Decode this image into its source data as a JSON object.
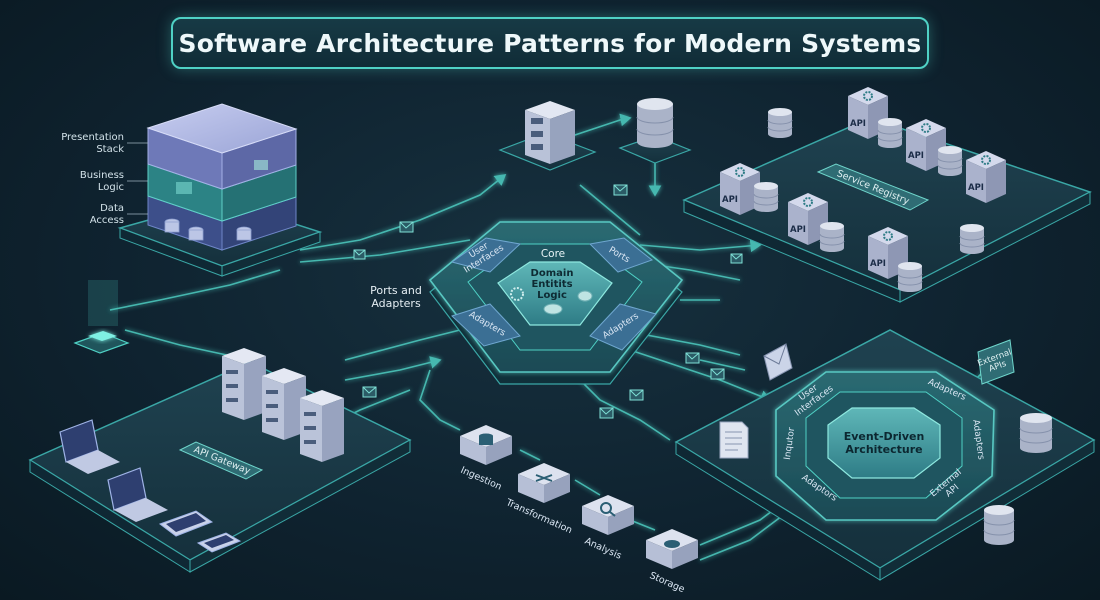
{
  "title": "Software Architecture Patterns for Modern Systems",
  "layered": {
    "labels": [
      {
        "line1": "Presentation",
        "line2": "Stack"
      },
      {
        "line1": "Business",
        "line2": "Logic"
      },
      {
        "line1": "Data",
        "line2": "Access"
      }
    ]
  },
  "hexagonal": {
    "core": "Core",
    "center": [
      "Domain",
      "Entitits",
      "Logic"
    ],
    "user_interfaces": [
      "User",
      "Interfaces"
    ],
    "ports": "Ports",
    "adapters_left": "Adapters",
    "adapters_right": "Adapters",
    "side_label": [
      "Ports and",
      "Adapters"
    ]
  },
  "microservices": {
    "registry": "Service Registry",
    "api_label": "API"
  },
  "gateway": {
    "label": "API Gateway"
  },
  "pipeline": {
    "steps": [
      "Ingestion",
      "Transformation",
      "Analysis",
      "Storage"
    ]
  },
  "event_driven": {
    "center": [
      "Event-Driven",
      "Architecture"
    ],
    "user_interfaces": [
      "User",
      "Interfaces"
    ],
    "adapters_top": "Adapters",
    "adapters_right": "Adapters",
    "adapters_bottom": "Adaptors",
    "inquptor": "Inqutor",
    "external_apis": [
      "External",
      "APIs"
    ],
    "external_api_bottom": [
      "External",
      "API"
    ]
  },
  "colors": {
    "background": "#0f2330",
    "accent": "#4fd1c5",
    "platform": "#1b3a47",
    "server": "#c9d3e6",
    "dark_panel": "#1d4a55"
  }
}
